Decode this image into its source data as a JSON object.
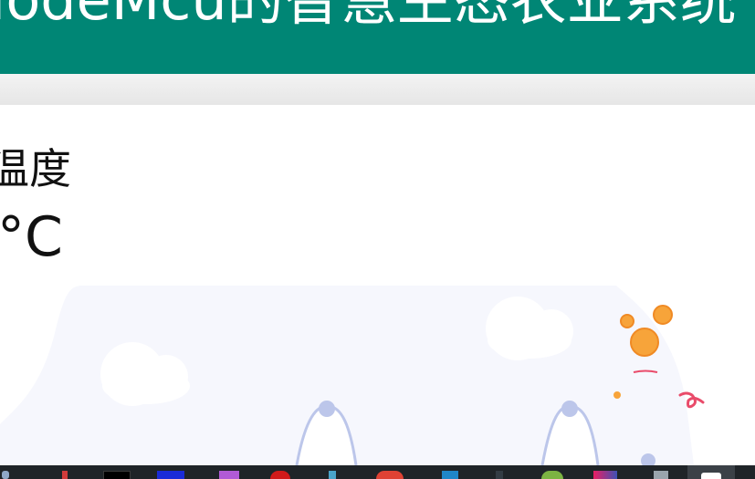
{
  "header": {
    "title": "NodeMcu的智慧生态农业系统"
  },
  "reading": {
    "label": "温度",
    "unit": "°C"
  },
  "colors": {
    "header_bg": "#008675",
    "illustration_bg": "#f6f7fd",
    "accent_orange": "#f7a43a",
    "accent_pink": "#e94b6a",
    "figure_outline": "#bcc6ea"
  },
  "taskbar": {
    "icons": [
      "start-icon",
      "red-app-icon",
      "black-app-icon",
      "blue-app-icon",
      "purple-app-icon",
      "red-circle-app-icon",
      "play-app-icon",
      "red-round-app-icon",
      "blue-diamond-app-icon",
      "dark-app-icon",
      "green-circle-app-icon",
      "multicolor-app-icon",
      "tray-app-icon",
      "active-window-icon"
    ]
  }
}
